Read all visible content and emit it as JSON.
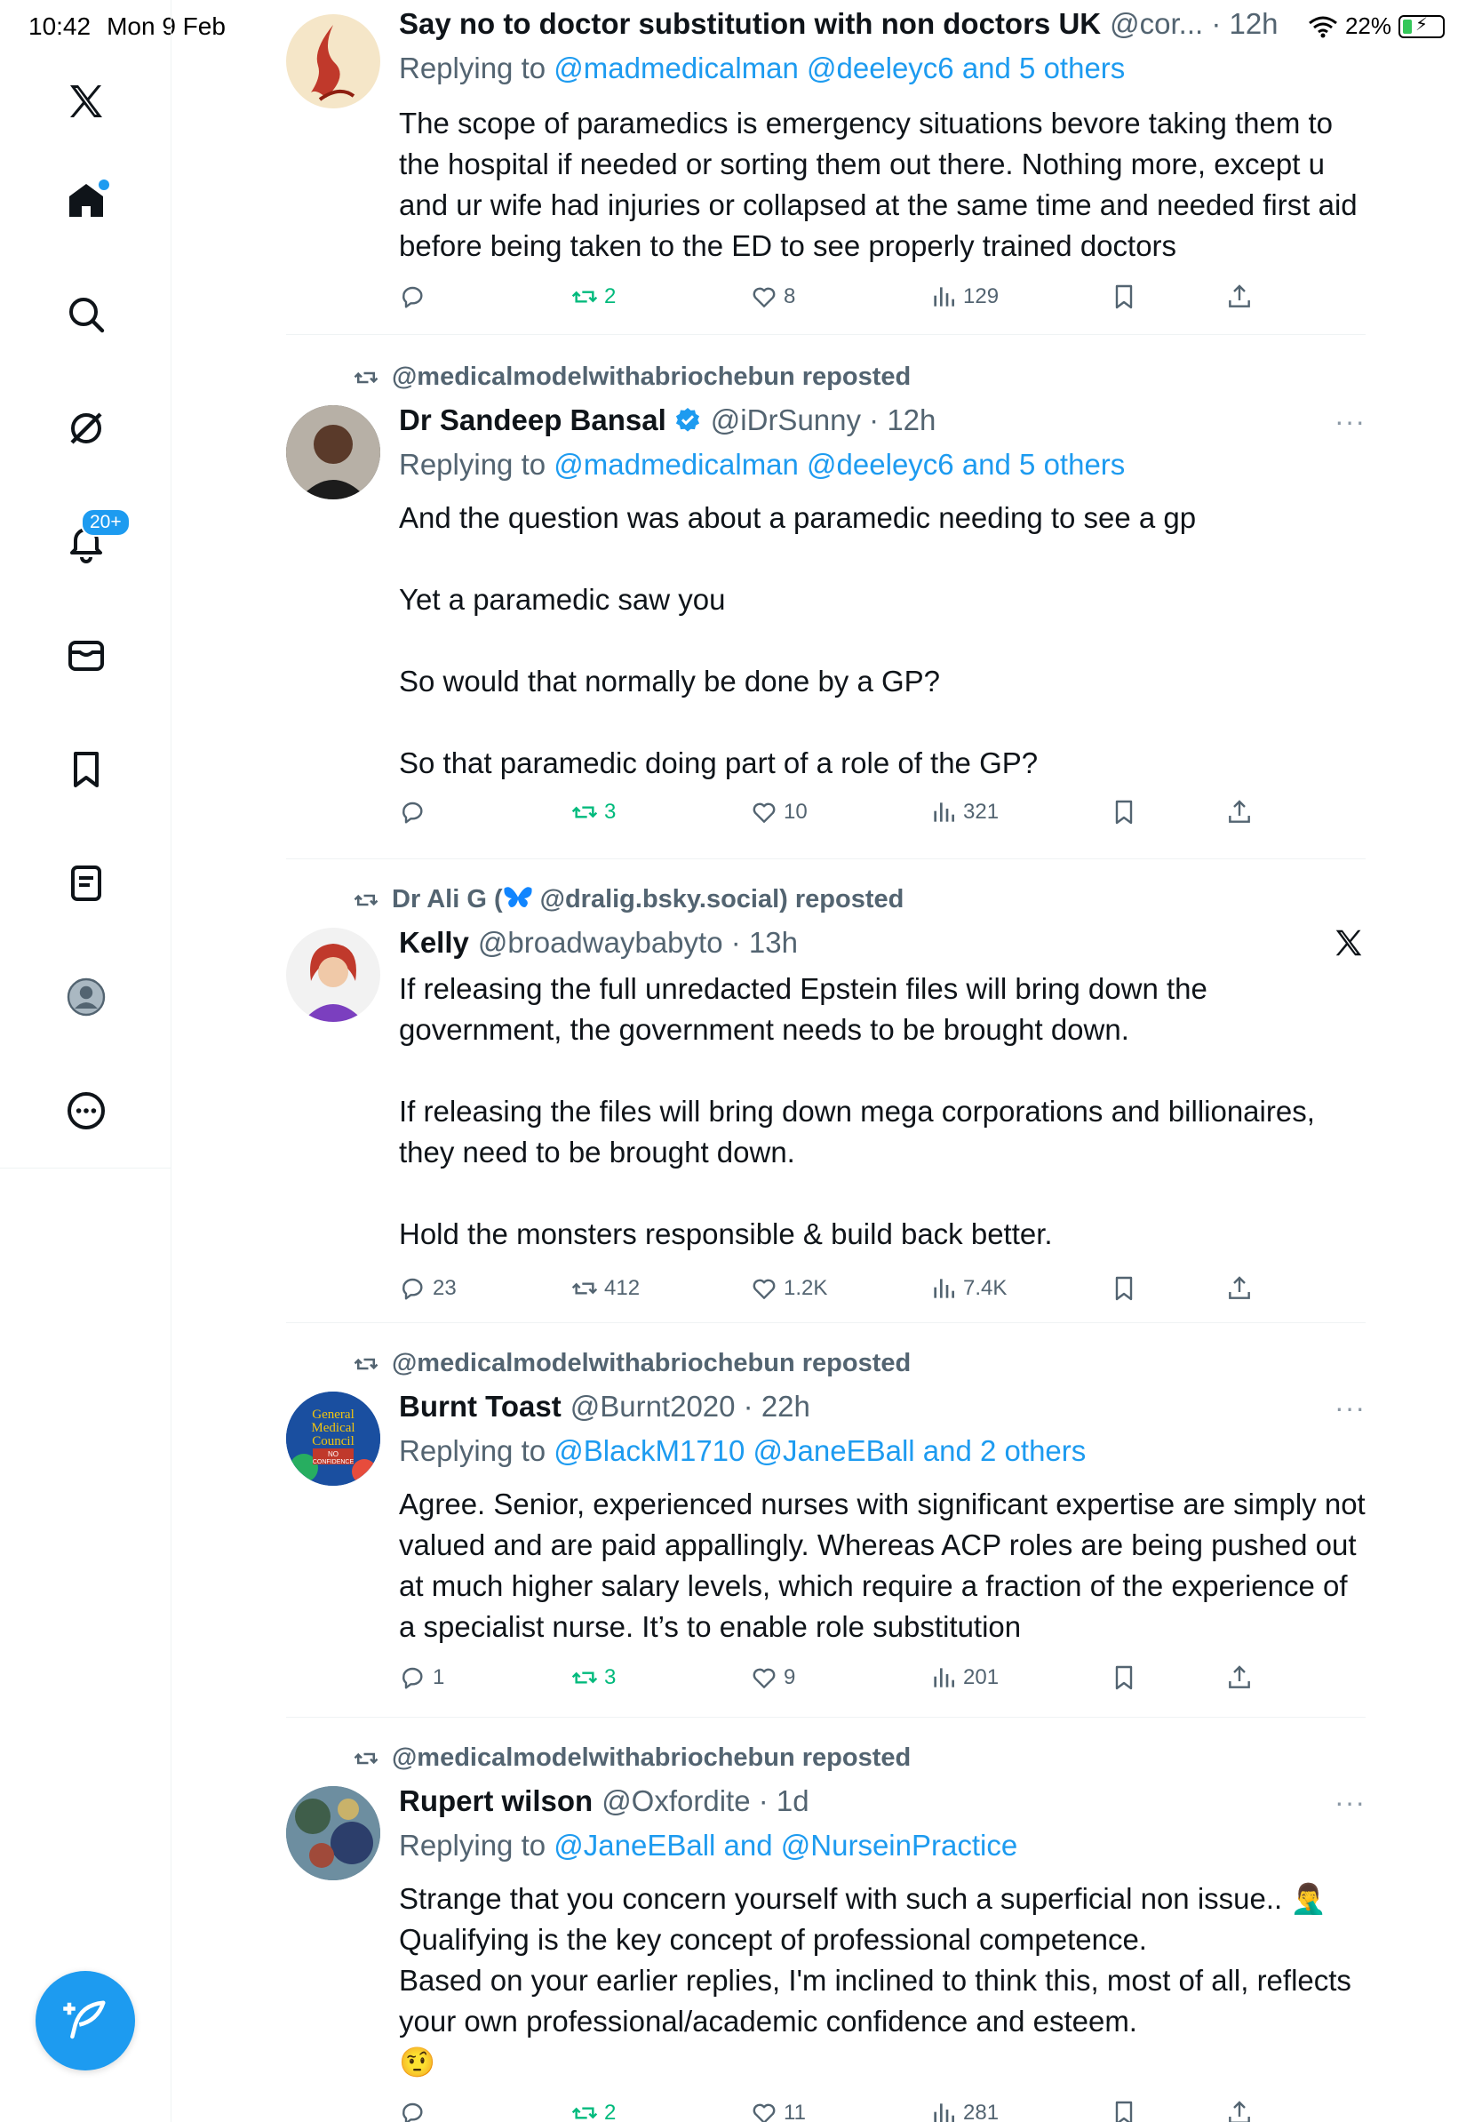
{
  "status_bar": {
    "time": "10:42",
    "date": "Mon 9 Feb",
    "battery": "22%",
    "battery_level": 0.22
  },
  "sidebar": {
    "items": [
      {
        "name": "home-icon",
        "has_dot": true
      },
      {
        "name": "search-icon"
      },
      {
        "name": "grok-icon"
      },
      {
        "name": "notifications-icon",
        "badge": "20+"
      },
      {
        "name": "messages-icon"
      },
      {
        "name": "bookmarks-icon"
      },
      {
        "name": "lists-icon"
      },
      {
        "name": "profile-icon"
      },
      {
        "name": "more-icon"
      }
    ],
    "accent": "#1d9bf0"
  },
  "posts": [
    {
      "repost_line": "",
      "name": "Say no to doctor substitution with non doctors UK",
      "handle": "@cor... · 12h",
      "replying_prefix": "Replying to",
      "replying_to": "@madmedicalman @deeleyc6 and 5 others",
      "body": [
        "The scope of paramedics is emergency situations bevore taking them to the hospital if needed or sorting them out there. Nothing more, except u and ur wife had injuries or collapsed at the same time and needed first aid before being taken to the ED to see properly trained doctors"
      ],
      "replies": "",
      "reposts": "2",
      "likes": "8",
      "views": "129"
    },
    {
      "repost_line": "@medicalmodelwithabriochebun reposted",
      "name": "Dr Sandeep Bansal",
      "verified": true,
      "handle": "@iDrSunny · 12h",
      "replying_prefix": "Replying to",
      "replying_to": "@madmedicalman @deeleyc6 and 5 others",
      "body": [
        "And the question was about a paramedic needing to see a gp",
        "",
        "Yet a paramedic saw you",
        "",
        "So would that normally be done by a GP?",
        "",
        "So that paramedic doing part of a role of the GP?"
      ],
      "replies": "",
      "reposts": "3",
      "likes": "10",
      "views": "321"
    },
    {
      "repost_line_prefix": "Dr Ali G (",
      "repost_line_suffix": " @dralig.bsky.social) reposted",
      "name": "Kelly",
      "handle": "@broadwaybabyto · 13h",
      "body": [
        "If releasing the full unredacted Epstein files will bring down the government, the government needs to be brought down.",
        "",
        "If releasing the files will bring down mega corporations and billionaires, they need to be brought down.",
        "",
        "Hold the monsters responsible & build back better."
      ],
      "replies": "23",
      "reposts": "412",
      "likes": "1.2K",
      "views": "7.4K"
    },
    {
      "repost_line": "@medicalmodelwithabriochebun reposted",
      "name": "Burnt Toast",
      "handle": "@Burnt2020 · 22h",
      "replying_prefix": "Replying to",
      "replying_to": "@BlackM1710 @JaneEBall and 2 others",
      "avatar_text": [
        "General",
        "Medical",
        "Council",
        "NO",
        "CONFIDENCE"
      ],
      "body": [
        "Agree. Senior, experienced nurses with significant expertise are simply not valued and are paid appallingly. Whereas ACP roles are being pushed out at much higher salary levels, which require a fraction of the experience of a specialist nurse. It’s to enable role substitution"
      ],
      "replies": "1",
      "reposts": "3",
      "likes": "9",
      "views": "201"
    },
    {
      "repost_line": "@medicalmodelwithabriochebun reposted",
      "name": "Rupert wilson",
      "handle": "@Oxfordite · 1d",
      "replying_prefix": "Replying to",
      "replying_to": "@JaneEBall and @NurseinPractice",
      "body": [
        "Strange that you concern yourself with such a superficial non issue.. 🤦‍♂️",
        "Qualifying is the key concept of professional competence.",
        "Based on your earlier replies, I'm inclined to think this, most of all, reflects your own professional/academic confidence and esteem.",
        "🤨"
      ],
      "replies": "",
      "reposts": "2",
      "likes": "11",
      "views": "281"
    }
  ],
  "more_label": "···"
}
